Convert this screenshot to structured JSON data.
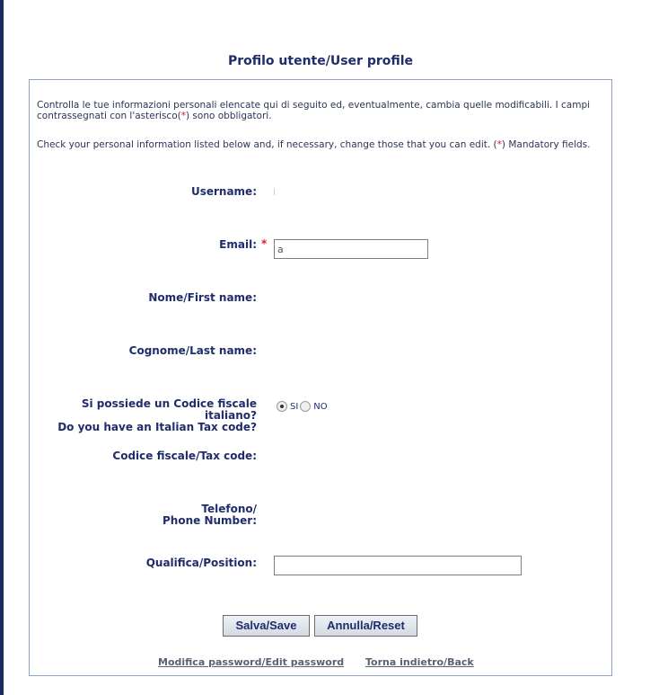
{
  "header": {
    "title": "Profilo utente/User profile"
  },
  "intro": {
    "it_before": "Controlla le tue informazioni personali elencate qui di seguito ed, eventualmente, cambia quelle modificabili. I campi contrassegnati con l'asterisco(",
    "it_star": "*",
    "it_after": ") sono obbligatori.",
    "en_before": "Check your personal information listed below and, if necessary, change those that you can edit. (",
    "en_star": "*",
    "en_after": ") Mandatory fields."
  },
  "form": {
    "username_label": "Username:",
    "email_label": "Email:",
    "email_required_mark": "*",
    "email_value": "a",
    "firstname_label": "Nome/First name:",
    "lastname_label": "Cognome/Last name:",
    "taxcode_question_it_1": "Si possiede un Codice fiscale",
    "taxcode_question_it_2": "italiano?",
    "taxcode_question_en": "Do you have an Italian Tax code?",
    "radio_yes": "SI",
    "radio_no": "NO",
    "radio_selected": "SI",
    "taxcode_label": "Codice fiscale/Tax code:",
    "phone_label_1": "Telefono/",
    "phone_label_2": "Phone Number:",
    "position_label": "Qualifica/Position:",
    "position_value": ""
  },
  "buttons": {
    "save": "Salva/Save",
    "reset": "Annulla/Reset"
  },
  "links": {
    "edit_password": "Modifica password/Edit password",
    "back": "Torna indietro/Back"
  },
  "colors": {
    "accent": "#1f2d6b",
    "required": "#e3172d",
    "pointer": "#e3172d"
  }
}
